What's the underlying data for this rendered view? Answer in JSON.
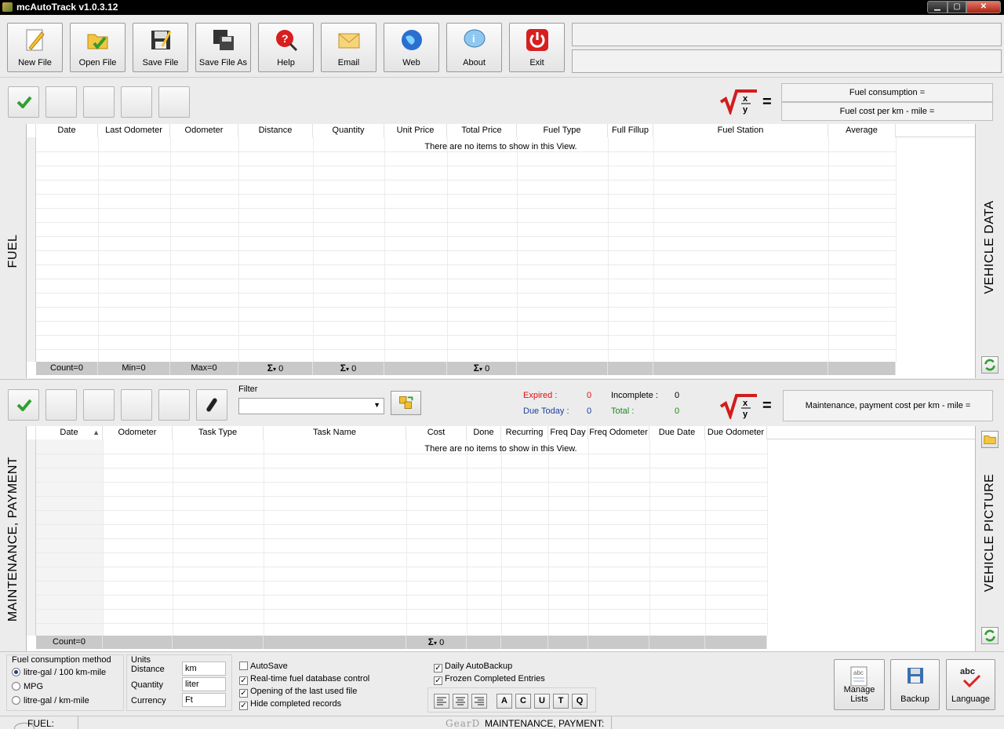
{
  "window": {
    "title": "mcAutoTrack v1.0.3.12"
  },
  "toolbar": {
    "buttons": [
      {
        "label": "New File",
        "icon": "new-file-icon"
      },
      {
        "label": "Open File",
        "icon": "open-file-icon"
      },
      {
        "label": "Save File",
        "icon": "save-file-icon"
      },
      {
        "label": "Save File As",
        "icon": "save-file-as-icon"
      },
      {
        "label": "Help",
        "icon": "help-icon"
      },
      {
        "label": "Email",
        "icon": "email-icon"
      },
      {
        "label": "Web",
        "icon": "web-icon"
      },
      {
        "label": "About",
        "icon": "about-icon"
      },
      {
        "label": "Exit",
        "icon": "exit-icon"
      }
    ]
  },
  "fuel": {
    "side_label": "FUEL",
    "right_label": "VEHICLE DATA",
    "formula_lines": [
      "Fuel consumption =",
      "Fuel cost per km - mile ="
    ],
    "columns": [
      "Date",
      "Last Odometer",
      "Odometer",
      "Distance",
      "Quantity",
      "Unit Price",
      "Total Price",
      "Fuel Type",
      "Full Fillup",
      "Fuel Station",
      "Average"
    ],
    "empty_message": "There are no items to show in this View.",
    "footer": [
      "Count=0",
      "Min=0",
      "Max=0",
      "0",
      "0",
      "",
      "0",
      "",
      "",
      "",
      ""
    ]
  },
  "maintenance": {
    "side_label": "MAINTENANCE, PAYMENT",
    "right_label": "VEHICLE PICTURE",
    "filter_label": "Filter",
    "status": {
      "expired_label": "Expired :",
      "expired_value": "0",
      "incomplete_label": "Incomplete :",
      "incomplete_value": "0",
      "due_today_label": "Due Today :",
      "due_today_value": "0",
      "total_label": "Total :",
      "total_value": "0",
      "expired_color": "#e01010",
      "due_color": "#1a3fa0",
      "total_color": "#1a8a1a"
    },
    "formula_line": "Maintenance, payment cost per km - mile =",
    "columns": [
      "Date",
      "Odometer",
      "Task Type",
      "Task Name",
      "Cost",
      "Done",
      "Recurring",
      "Freq Day",
      "Freq Odometer",
      "Due Date",
      "Due Odometer"
    ],
    "empty_message": "There are no items to show in this View.",
    "footer": [
      "Count=0",
      "",
      "",
      "",
      "0",
      "",
      "",
      "",
      "",
      "",
      ""
    ]
  },
  "options": {
    "method_title": "Fuel consumption method",
    "methods": [
      {
        "label": "litre-gal / 100 km-mile",
        "selected": true
      },
      {
        "label": "MPG",
        "selected": false
      },
      {
        "label": "litre-gal / km-mile",
        "selected": false
      }
    ],
    "units_title": "Units",
    "units": [
      {
        "label": "Distance",
        "value": "km"
      },
      {
        "label": "Quantity",
        "value": "liter"
      },
      {
        "label": "Currency",
        "value": "Ft"
      }
    ],
    "checks_left": [
      {
        "label": "AutoSave",
        "checked": false
      },
      {
        "label": "Real-time fuel database control",
        "checked": true
      },
      {
        "label": "Opening of the last used file",
        "checked": true
      },
      {
        "label": "Hide completed records",
        "checked": true
      }
    ],
    "checks_right": [
      {
        "label": "Daily AutoBackup",
        "checked": true
      },
      {
        "label": "Frozen Completed Entries",
        "checked": true
      }
    ],
    "letter_buttons": [
      "A",
      "C",
      "U",
      "T",
      "Q"
    ],
    "big_buttons": [
      {
        "label": "Manage Lists",
        "icon": "manage-lists-icon"
      },
      {
        "label": "Backup",
        "icon": "backup-icon"
      },
      {
        "label": "Language",
        "icon": "language-icon"
      }
    ]
  },
  "statusbar": {
    "fuel": "FUEL:",
    "maintenance": "MAINTENANCE, PAYMENT:",
    "watermark": "GearD"
  }
}
